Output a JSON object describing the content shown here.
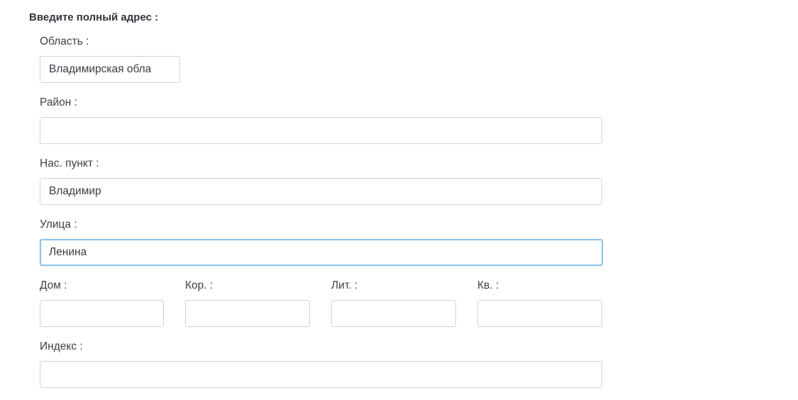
{
  "form": {
    "title": "Введите полный адрес :",
    "region": {
      "label": "Область :",
      "value": "Владимирская обла"
    },
    "district": {
      "label": "Район :",
      "value": ""
    },
    "locality": {
      "label": "Нас. пункт :",
      "value": "Владимир"
    },
    "street": {
      "label": "Улица :",
      "value": "Ленина"
    },
    "house": {
      "label": "Дом :",
      "value": ""
    },
    "building": {
      "label": "Кор. :",
      "value": ""
    },
    "letter": {
      "label": "Лит. :",
      "value": ""
    },
    "apartment": {
      "label": "Кв. :",
      "value": ""
    },
    "postcode": {
      "label": "Индекс :",
      "value": ""
    }
  }
}
